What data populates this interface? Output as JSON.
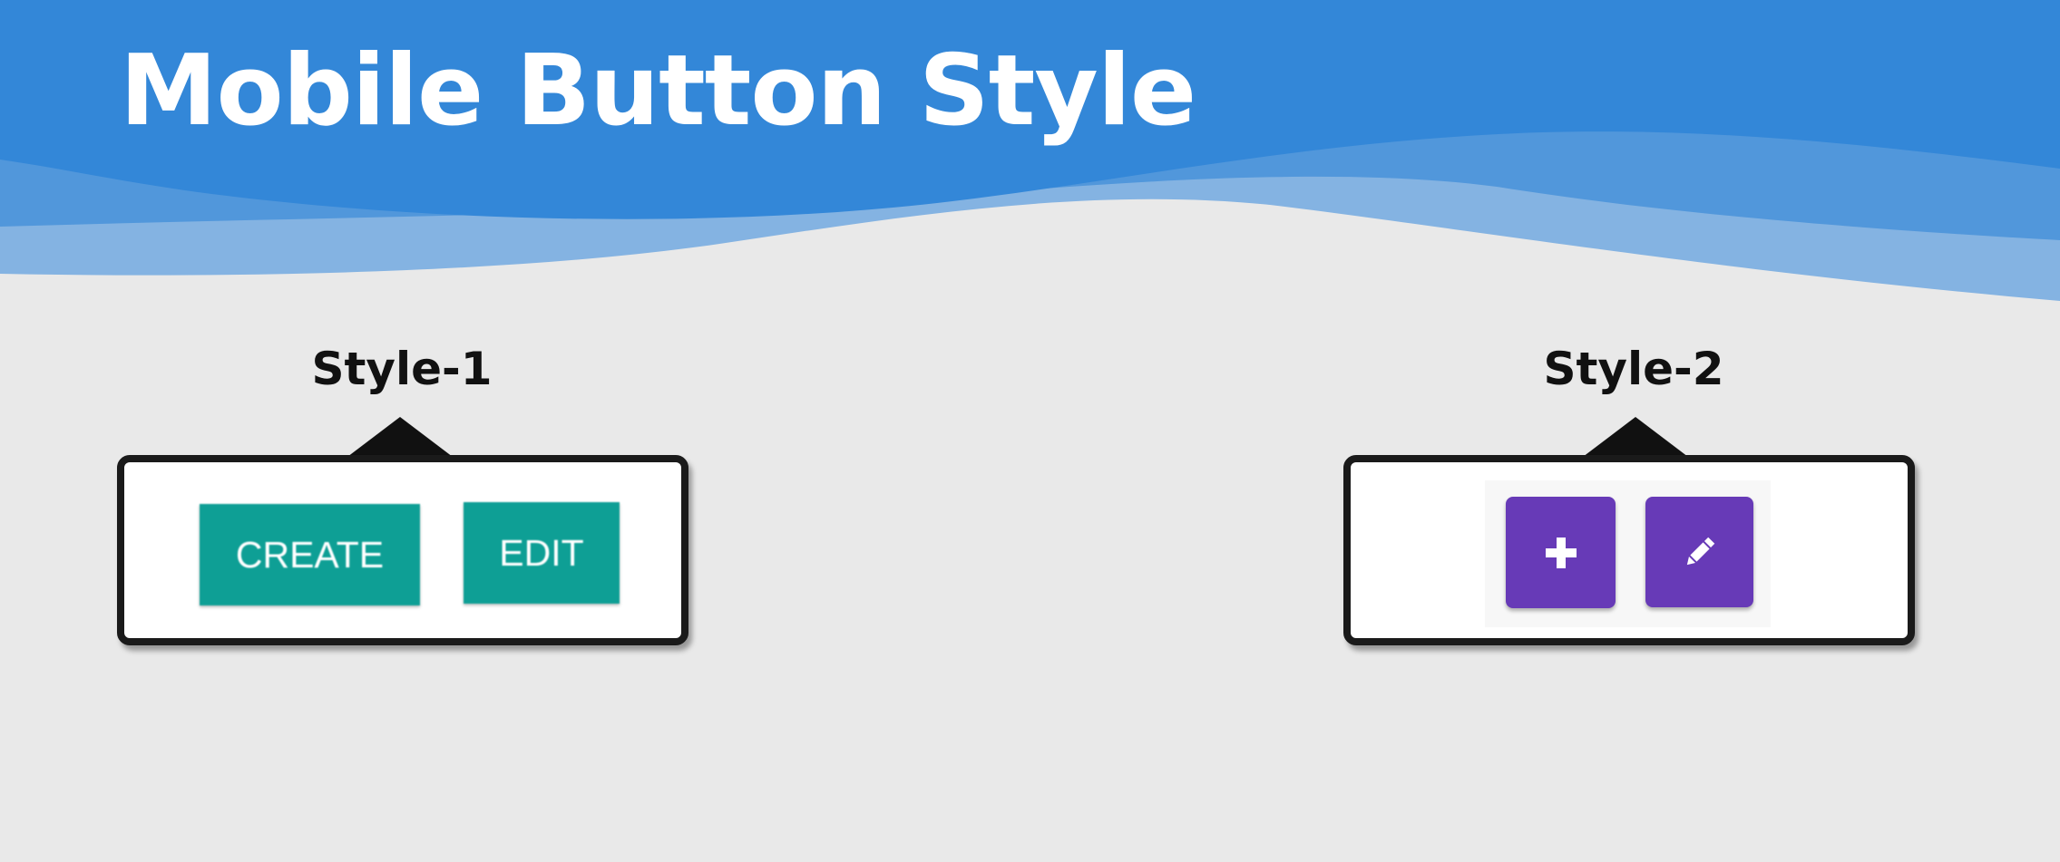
{
  "header": {
    "title": "Mobile Button Style",
    "colors": {
      "band": "#3387d8",
      "wave_mid": "#5197db",
      "wave_light": "#84b3e2"
    }
  },
  "style1": {
    "label": "Style-1",
    "buttons": [
      {
        "label": "CREATE"
      },
      {
        "label": "EDIT"
      }
    ],
    "button_color": "#0e9f95"
  },
  "style2": {
    "label": "Style-2",
    "buttons": [
      {
        "icon": "plus-icon"
      },
      {
        "icon": "pencil-icon"
      }
    ],
    "button_color": "#673ab7"
  }
}
